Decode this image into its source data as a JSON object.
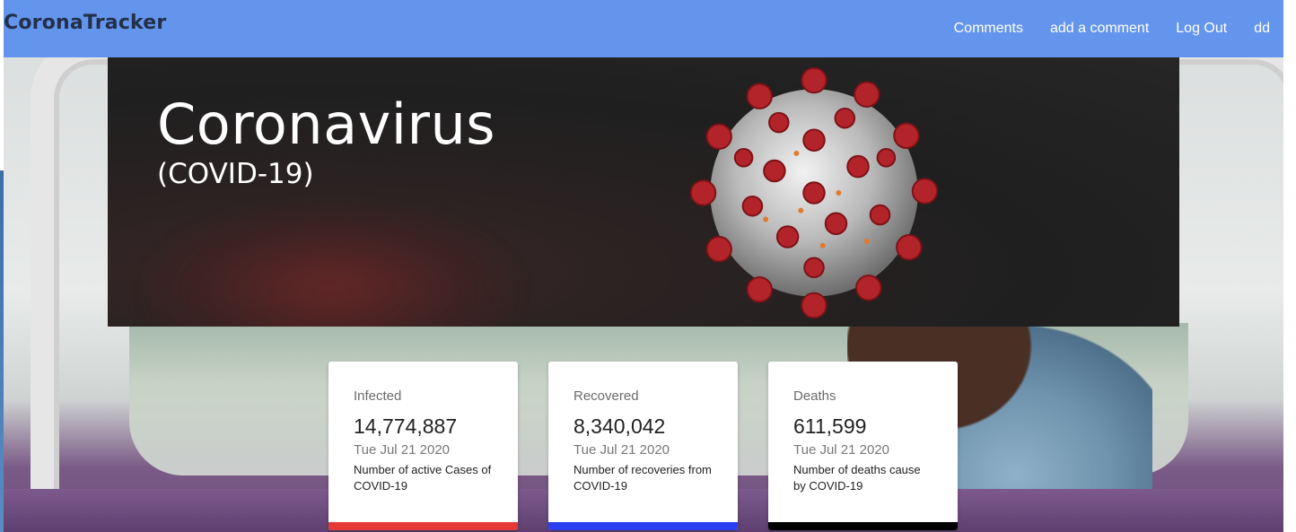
{
  "navbar": {
    "brand": "CoronaTracker",
    "links": [
      {
        "label": "Comments"
      },
      {
        "label": "add a comment"
      },
      {
        "label": "Log Out"
      },
      {
        "label": "dd"
      }
    ],
    "background_color": "#6495ed"
  },
  "hero": {
    "title": "Coronavirus",
    "subtitle": "(COVID-19)"
  },
  "cards": [
    {
      "label": "Infected",
      "value": "14,774,887",
      "date": "Tue Jul 21 2020",
      "description": "Number of active Cases of COVID-19",
      "accent_color": "#e53935"
    },
    {
      "label": "Recovered",
      "value": "8,340,042",
      "date": "Tue Jul 21 2020",
      "description": "Number of recoveries from COVID-19",
      "accent_color": "#2a3ef0"
    },
    {
      "label": "Deaths",
      "value": "611,599",
      "date": "Tue Jul 21 2020",
      "description": "Number of deaths cause by COVID-19",
      "accent_color": "#000000"
    }
  ]
}
